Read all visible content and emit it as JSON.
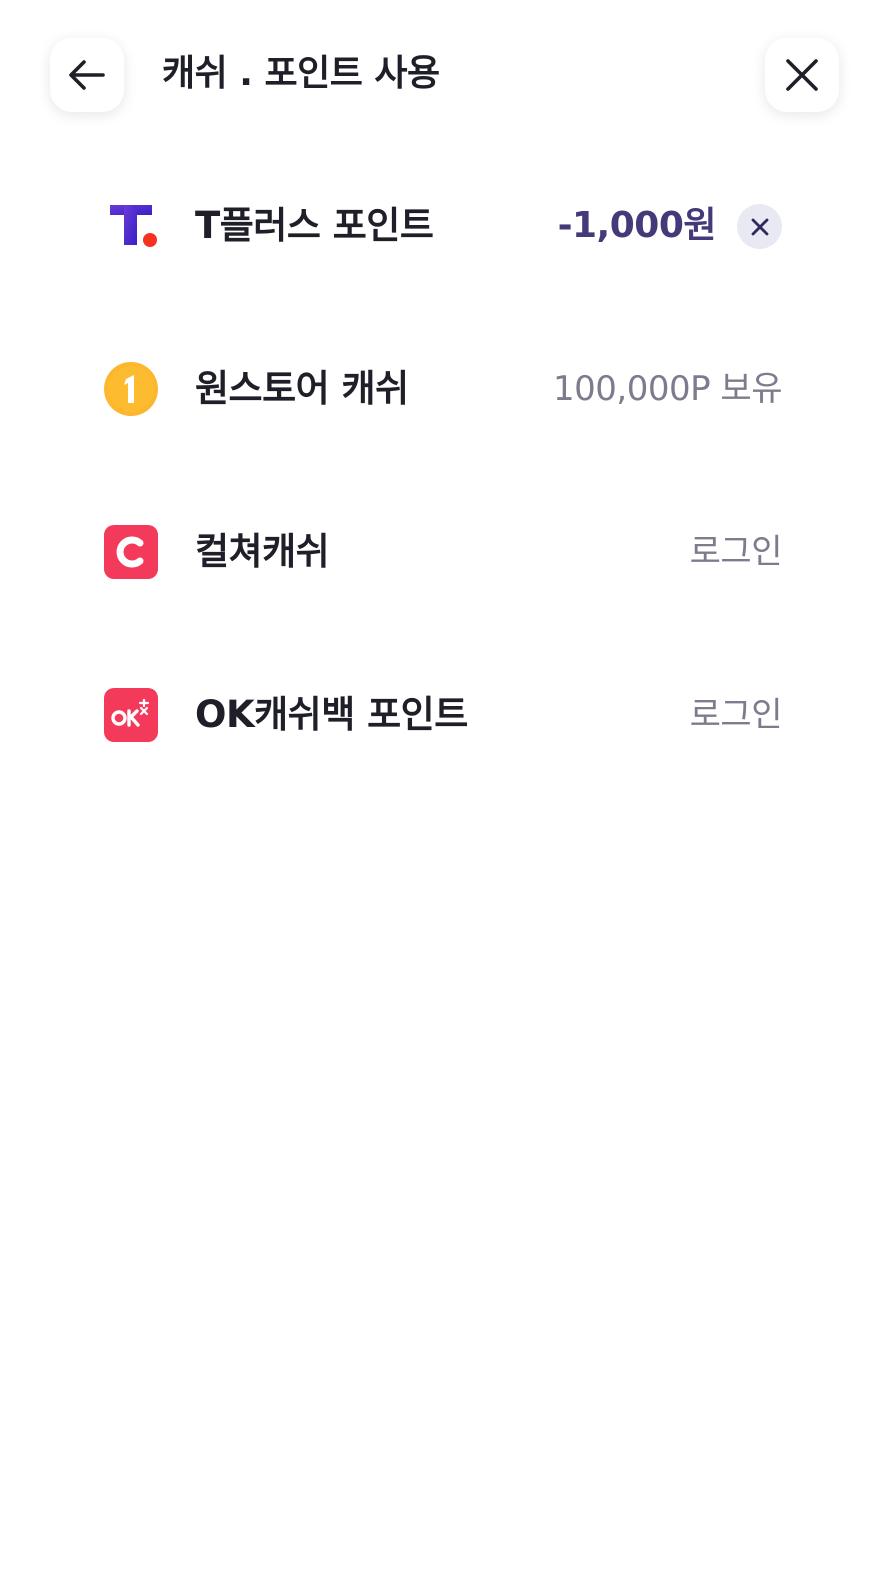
{
  "header": {
    "title": "캐쉬 . 포인트 사용",
    "back_icon": "arrow-left-icon",
    "close_icon": "close-icon"
  },
  "items": [
    {
      "name": "T플러스 포인트",
      "logo": "tplus-logo-icon",
      "amount": "-1,000원",
      "clear_icon": "clear-x-icon",
      "amount_color": "#433a7a"
    },
    {
      "name": "원스토어 캐쉬",
      "logo": "onestore-coin-icon",
      "status": "100,000P 보유"
    },
    {
      "name": "컬쳐캐쉬",
      "logo": "culture-cash-icon",
      "status": "로그인"
    },
    {
      "name": "OK캐쉬백 포인트",
      "logo": "ok-cashbag-icon",
      "status": "로그인"
    }
  ],
  "colors": {
    "text_primary": "#1f1f29",
    "text_secondary": "#7d7c8f",
    "accent_purple": "#433a7a",
    "culture_red": "#f43a5a",
    "onestore_yellow": "#fcb72e"
  }
}
